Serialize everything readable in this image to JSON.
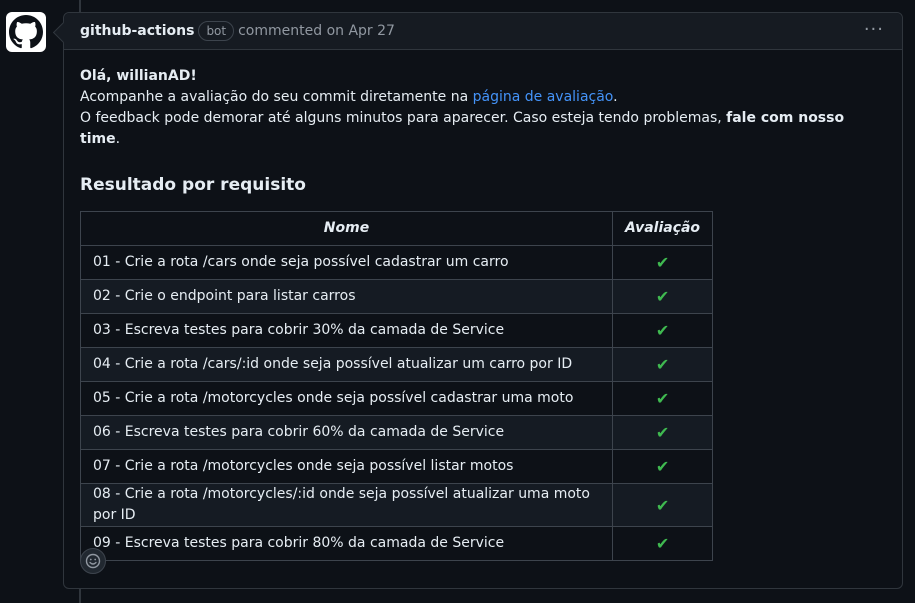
{
  "header": {
    "author": "github-actions",
    "badge": "bot",
    "meta": "commented on Apr 27",
    "menu": "···"
  },
  "body": {
    "greeting": "Olá, willianAD!",
    "line2_prefix": "Acompanhe a avaliação do seu commit diretamente na ",
    "line2_link": "página de avaliação",
    "line2_suffix": ".",
    "line3_prefix": "O feedback pode demorar até alguns minutos para aparecer. Caso esteja tendo problemas, ",
    "line3_bold": "fale com nosso time",
    "line3_suffix": "."
  },
  "section_title": "Resultado por requisito",
  "table": {
    "headers": [
      "Nome",
      "Avaliação"
    ],
    "check_glyph": "✔",
    "check_color": "#3fb950",
    "rows": [
      {
        "name": "01 - Crie a rota /cars onde seja possível cadastrar um carro",
        "status": "✔"
      },
      {
        "name": "02 - Crie o endpoint para listar carros",
        "status": "✔"
      },
      {
        "name": "03 - Escreva testes para cobrir 30% da camada de Service",
        "status": "✔"
      },
      {
        "name": "04 - Crie a rota /cars/:id onde seja possível atualizar um carro por ID",
        "status": "✔"
      },
      {
        "name": "05 - Crie a rota /motorcycles onde seja possível cadastrar uma moto",
        "status": "✔"
      },
      {
        "name": "06 - Escreva testes para cobrir 60% da camada de Service",
        "status": "✔"
      },
      {
        "name": "07 - Crie a rota /motorcycles onde seja possível listar motos",
        "status": "✔"
      },
      {
        "name": "08 - Crie a rota /motorcycles/:id onde seja possível atualizar uma moto por ID",
        "status": "✔"
      },
      {
        "name": "09 - Escreva testes para cobrir 80% da camada de Service",
        "status": "✔"
      }
    ]
  },
  "icons": {
    "avatar": "github-logo-icon",
    "reaction": "smiley-icon",
    "menu": "kebab-icon"
  },
  "colors": {
    "background": "#0d1117",
    "header_bg": "#161b22",
    "border": "#30363d",
    "link": "#4493f8",
    "success": "#3fb950"
  }
}
